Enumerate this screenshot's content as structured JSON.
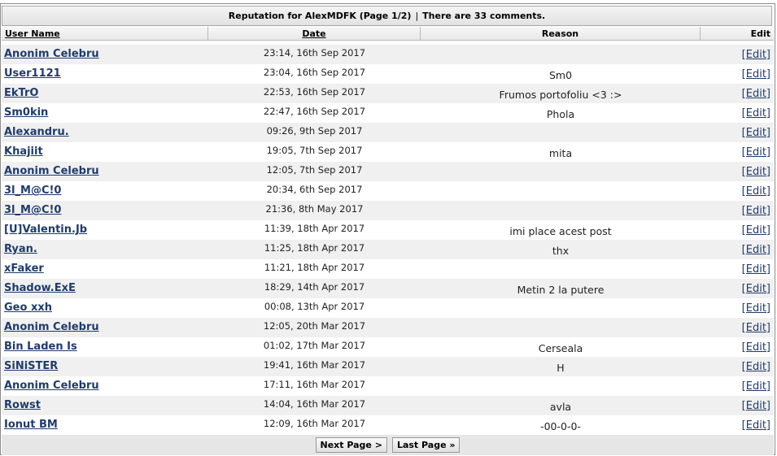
{
  "title": {
    "left": "Reputation for AlexMDFK (Page 1/2)",
    "separator": "|",
    "right": "There are 33 comments."
  },
  "columns": {
    "user": "User Name",
    "date": "Date",
    "reason": "Reason",
    "edit": "Edit"
  },
  "rows": [
    {
      "user": "Anonim Celebru",
      "date": "23:14, 16th Sep 2017",
      "reason": "",
      "edit": "[Edit]"
    },
    {
      "user": "User1121",
      "date": "23:04, 16th Sep 2017",
      "reason": "Sm0",
      "edit": "[Edit]"
    },
    {
      "user": "EkTrO",
      "date": "22:53, 16th Sep 2017",
      "reason": "Frumos portofoliu <3 :>",
      "edit": "[Edit]"
    },
    {
      "user": "Sm0kin",
      "date": "22:47, 16th Sep 2017",
      "reason": "Phola",
      "edit": "[Edit]"
    },
    {
      "user": "Alexandru.",
      "date": "09:26, 9th Sep 2017",
      "reason": "",
      "edit": "[Edit]"
    },
    {
      "user": "Khajiit",
      "date": "19:05, 7th Sep 2017",
      "reason": "mita",
      "edit": "[Edit]"
    },
    {
      "user": "Anonim Celebru",
      "date": "12:05, 7th Sep 2017",
      "reason": "",
      "edit": "[Edit]"
    },
    {
      "user": "3l_M@C!0",
      "date": "20:34, 6th Sep 2017",
      "reason": "",
      "edit": "[Edit]"
    },
    {
      "user": "3l_M@C!0",
      "date": "21:36, 8th May 2017",
      "reason": "",
      "edit": "[Edit]"
    },
    {
      "user": "[U]Valentin.Jb",
      "date": "11:39, 18th Apr 2017",
      "reason": "imi place acest post",
      "edit": "[Edit]"
    },
    {
      "user": "Ryan.",
      "date": "11:25, 18th Apr 2017",
      "reason": "thx",
      "edit": "[Edit]"
    },
    {
      "user": "xFaker",
      "date": "11:21, 18th Apr 2017",
      "reason": "",
      "edit": "[Edit]"
    },
    {
      "user": "Shadow.ExE",
      "date": "18:29, 14th Apr 2017",
      "reason": "Metin 2 la putere",
      "edit": "[Edit]"
    },
    {
      "user": "Geo xxh",
      "date": "00:08, 13th Apr 2017",
      "reason": "",
      "edit": "[Edit]"
    },
    {
      "user": "Anonim Celebru",
      "date": "12:05, 20th Mar 2017",
      "reason": "",
      "edit": "[Edit]"
    },
    {
      "user": "Bin Laden Is",
      "date": "01:02, 17th Mar 2017",
      "reason": "Cerseala",
      "edit": "[Edit]"
    },
    {
      "user": "SiNiSTER",
      "date": "19:41, 16th Mar 2017",
      "reason": "H",
      "edit": "[Edit]"
    },
    {
      "user": "Anonim Celebru",
      "date": "17:11, 16th Mar 2017",
      "reason": "",
      "edit": "[Edit]"
    },
    {
      "user": "Rowst",
      "date": "14:04, 16th Mar 2017",
      "reason": "avla",
      "edit": "[Edit]"
    },
    {
      "user": "Ionut BM",
      "date": "12:09, 16th Mar 2017",
      "reason": "-00-0-0-",
      "edit": "[Edit]"
    }
  ],
  "pagination": {
    "next": "Next Page >",
    "last": "Last Page »"
  }
}
